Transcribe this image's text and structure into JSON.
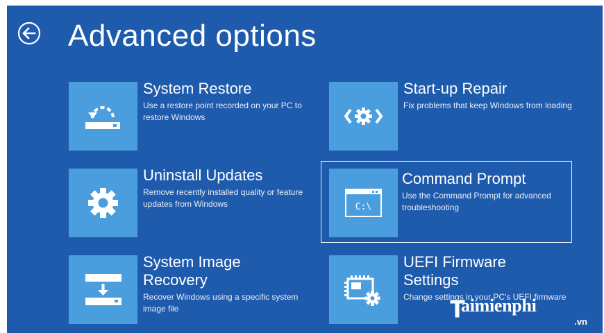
{
  "header": {
    "title": "Advanced options"
  },
  "options": [
    {
      "id": "system-restore",
      "title": "System Restore",
      "description": "Use a restore point recorded on your PC to restore Windows",
      "icon": "restore-icon"
    },
    {
      "id": "startup-repair",
      "title": "Start-up Repair",
      "description": "Fix problems that keep Windows from loading",
      "icon": "repair-gear-icon"
    },
    {
      "id": "uninstall-updates",
      "title": "Uninstall Updates",
      "description": "Remove recently installed quality or feature updates from Windows",
      "icon": "gear-icon"
    },
    {
      "id": "command-prompt",
      "title": "Command Prompt",
      "description": "Use the Command Prompt for advanced troubleshooting",
      "icon": "command-prompt-icon",
      "icon_text": "C:\\",
      "selected": true
    },
    {
      "id": "system-image-recovery",
      "title": "System Image Recovery",
      "description": "Recover Windows using a specific system image file",
      "icon": "image-recovery-icon"
    },
    {
      "id": "uefi-firmware-settings",
      "title": "UEFI Firmware Settings",
      "description": "Change settings in your PC's UEFI firmware",
      "icon": "firmware-chip-icon"
    }
  ],
  "watermark": {
    "text": "aimienphi",
    "suffix": ".vn"
  },
  "colors": {
    "background": "#1f5bad",
    "tile": "#4b9ede",
    "text": "#ffffff"
  }
}
